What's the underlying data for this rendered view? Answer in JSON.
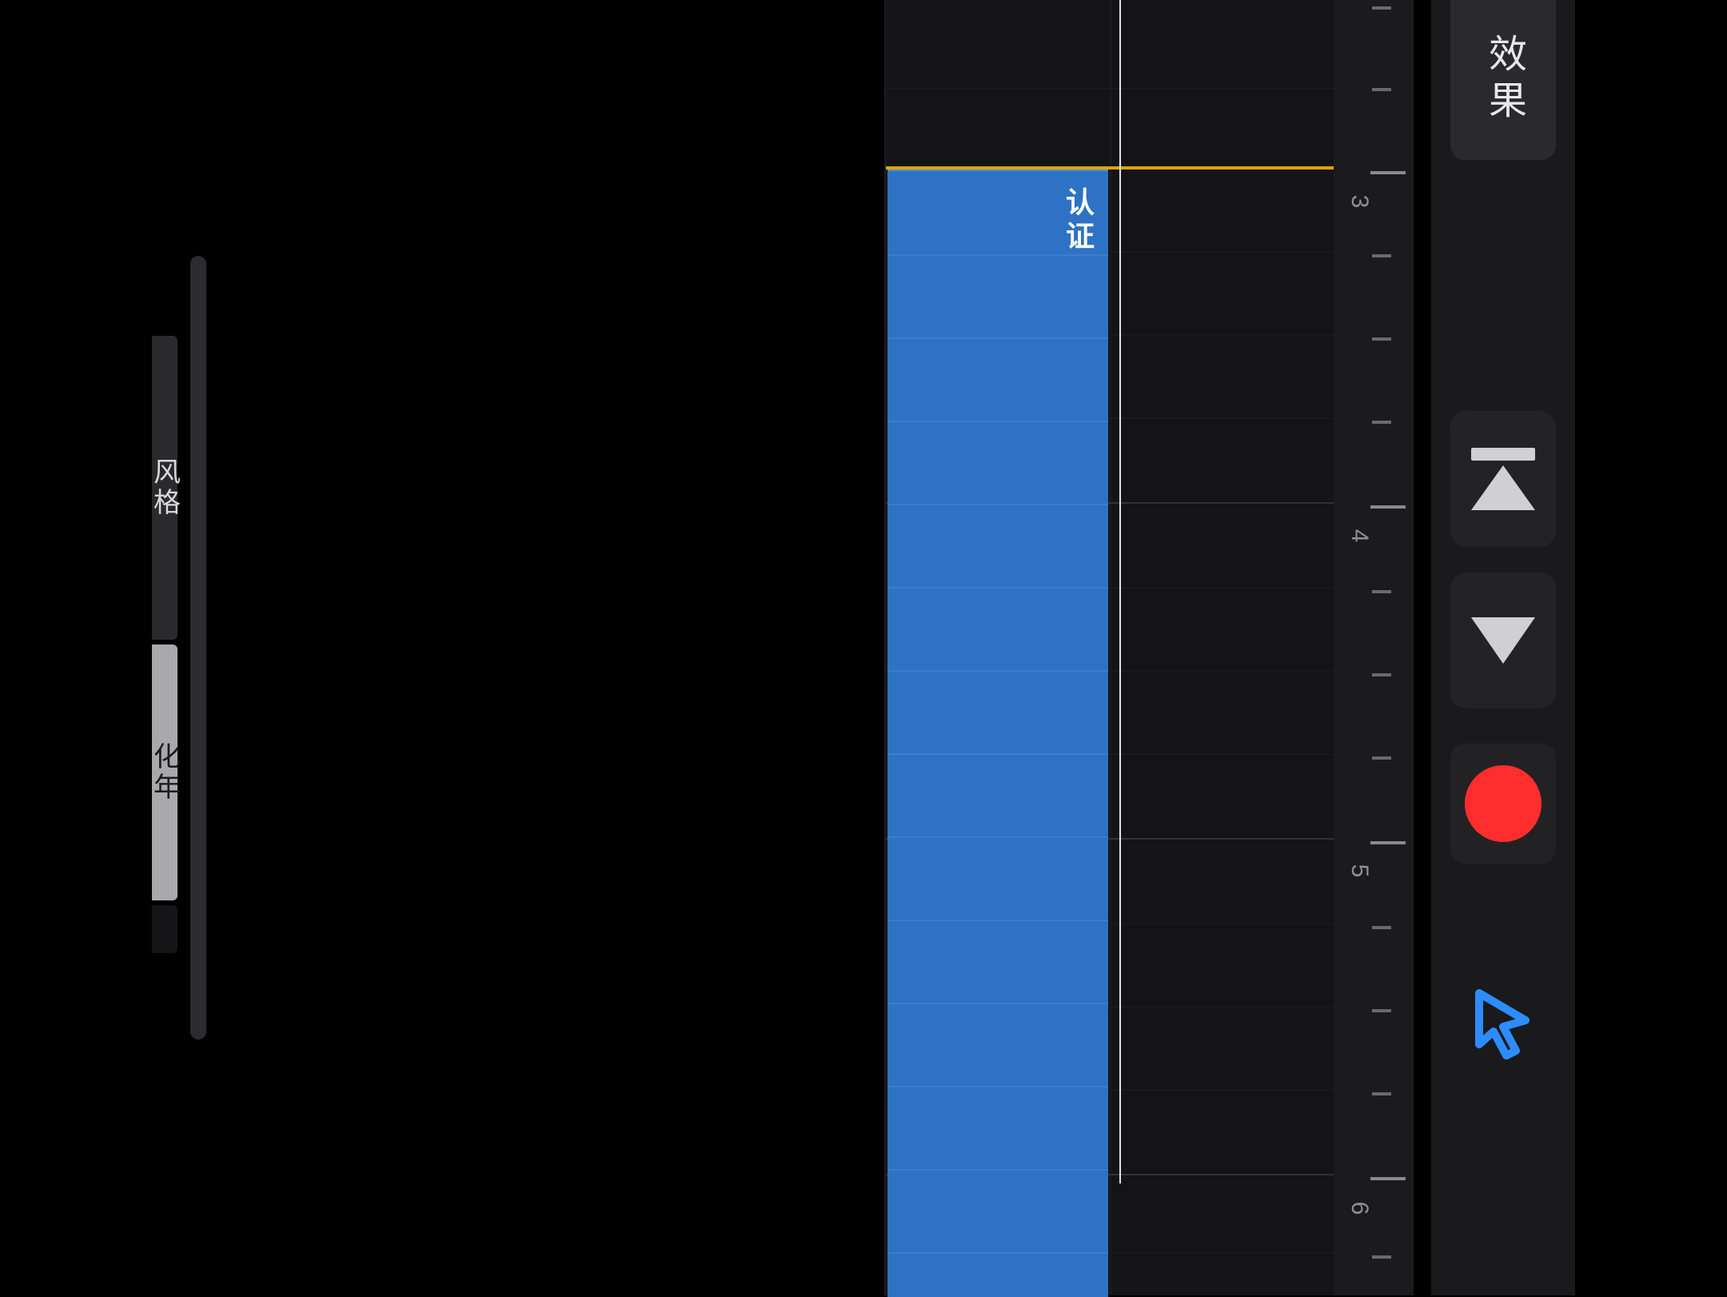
{
  "leftbar": {
    "items": [
      {
        "label": "风格"
      },
      {
        "label": "化年"
      }
    ]
  },
  "timeline": {
    "region_label": "认证",
    "bar_numbers": [
      "3",
      "4",
      "5",
      "6"
    ]
  },
  "controls": {
    "effects_label": "效果"
  },
  "colors": {
    "region": "#2d72c4",
    "record": "#ff2d2d",
    "cursor": "#2d8cff",
    "cycle": "#e0a400"
  }
}
